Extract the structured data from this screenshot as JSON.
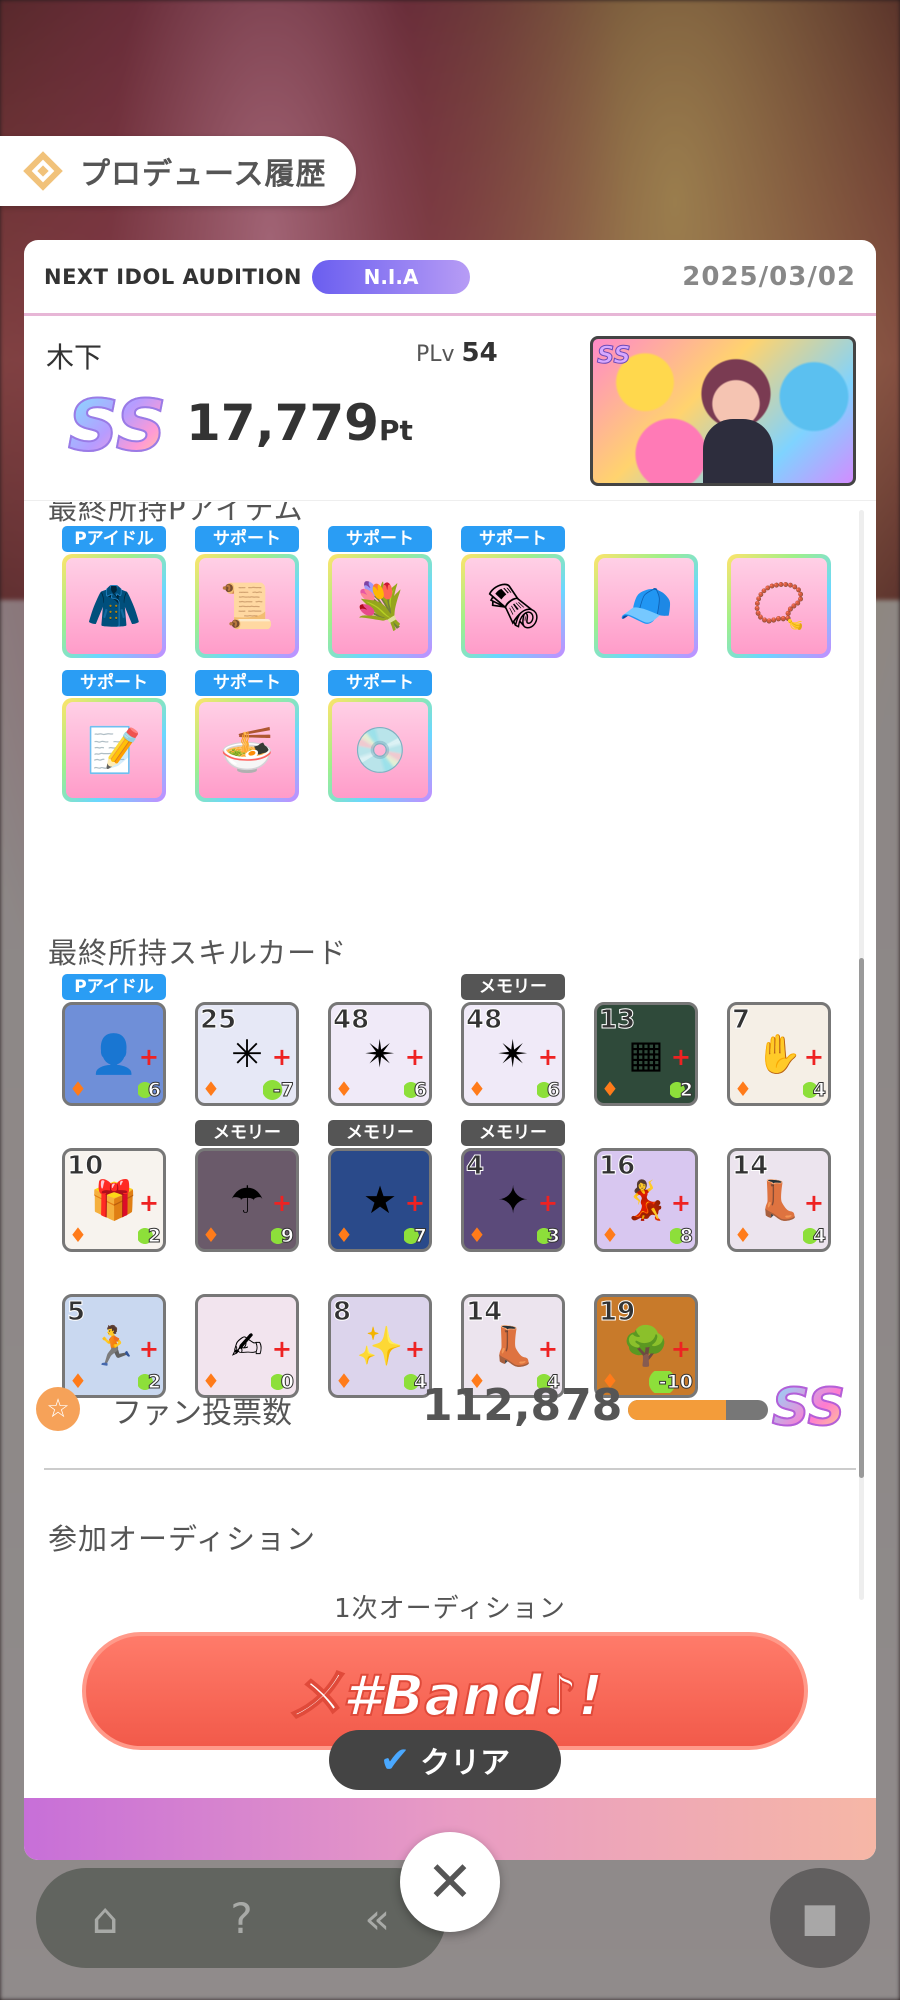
{
  "header": {
    "title": "プロデュース履歴"
  },
  "audition": {
    "name": "NEXT IDOL AUDITION",
    "badge": "N.I.A",
    "date": "2025/03/02"
  },
  "summary": {
    "player_name": "木下",
    "plv_label": "PLv",
    "plv_value": "54",
    "rank": "SS",
    "score": "17,779",
    "score_unit": "Pt",
    "thumb_rank": "SS"
  },
  "items_section": {
    "title": "最終所持Pアイテム",
    "items": [
      {
        "tag": "Pアイドル",
        "tag_color": "blue",
        "icon": "jacket-icon",
        "glyph": "🧥"
      },
      {
        "tag": "サポート",
        "tag_color": "blue",
        "icon": "certificate-icon",
        "glyph": "📜"
      },
      {
        "tag": "サポート",
        "tag_color": "blue",
        "icon": "bouquet-icon",
        "glyph": "💐"
      },
      {
        "tag": "サポート",
        "tag_color": "blue",
        "icon": "poster-icon",
        "glyph": "🗞"
      },
      {
        "tag": "",
        "tag_color": "",
        "icon": "nia-cap-icon",
        "glyph": "🧢"
      },
      {
        "tag": "",
        "tag_color": "",
        "icon": "bracelet-icon",
        "glyph": "📿"
      },
      {
        "tag": "サポート",
        "tag_color": "blue",
        "icon": "notepad-icon",
        "glyph": "📝"
      },
      {
        "tag": "サポート",
        "tag_color": "blue",
        "icon": "ramen-ticket-icon",
        "glyph": "🍜"
      },
      {
        "tag": "サポート",
        "tag_color": "blue",
        "icon": "record-icon",
        "glyph": "💿"
      }
    ]
  },
  "skills_section": {
    "title": "最終所持スキルカード",
    "cards": [
      {
        "tag": "Pアイドル",
        "tag_color": "blue",
        "cost": "",
        "leaf": "6",
        "bg": "#6f8fd8",
        "glyph": "👤"
      },
      {
        "tag": "",
        "tag_color": "",
        "cost": "25",
        "leaf": "-7",
        "bg": "#e6e8f6",
        "glyph": "✳"
      },
      {
        "tag": "",
        "tag_color": "",
        "cost": "48",
        "leaf": "6",
        "bg": "#f0eaf8",
        "glyph": "✴"
      },
      {
        "tag": "メモリー",
        "tag_color": "dark",
        "cost": "48",
        "leaf": "6",
        "bg": "#f0eaf8",
        "glyph": "✴"
      },
      {
        "tag": "",
        "tag_color": "",
        "cost": "13",
        "leaf": "2",
        "bg": "#2f4a3a",
        "glyph": "▦"
      },
      {
        "tag": "",
        "tag_color": "",
        "cost": "7",
        "leaf": "4",
        "bg": "#f5efe6",
        "glyph": "✋"
      },
      {
        "tag": "",
        "tag_color": "",
        "cost": "10",
        "leaf": "2",
        "bg": "#f7f3ee",
        "glyph": "🎁"
      },
      {
        "tag": "メモリー",
        "tag_color": "dark",
        "cost": "",
        "leaf": "9",
        "bg": "#6a5a6a",
        "glyph": "☂"
      },
      {
        "tag": "メモリー",
        "tag_color": "dark",
        "cost": "",
        "leaf": "7",
        "bg": "#2a4a8a",
        "glyph": "★"
      },
      {
        "tag": "メモリー",
        "tag_color": "dark",
        "cost": "4",
        "leaf": "3",
        "bg": "#5b4a7a",
        "glyph": "✦"
      },
      {
        "tag": "",
        "tag_color": "",
        "cost": "16",
        "leaf": "8",
        "bg": "#d8c7f0",
        "glyph": "💃"
      },
      {
        "tag": "",
        "tag_color": "",
        "cost": "14",
        "leaf": "4",
        "bg": "#ece4ee",
        "glyph": "👢"
      },
      {
        "tag": "",
        "tag_color": "",
        "cost": "5",
        "leaf": "2",
        "bg": "#c9d8f0",
        "glyph": "🏃"
      },
      {
        "tag": "",
        "tag_color": "",
        "cost": "",
        "leaf": "0",
        "bg": "#f2e4ee",
        "glyph": "✍"
      },
      {
        "tag": "",
        "tag_color": "",
        "cost": "8",
        "leaf": "4",
        "bg": "#dcd4ec",
        "glyph": "✨"
      },
      {
        "tag": "",
        "tag_color": "",
        "cost": "14",
        "leaf": "4",
        "bg": "#ece4ee",
        "glyph": "👢"
      },
      {
        "tag": "",
        "tag_color": "",
        "cost": "19",
        "leaf": "-10",
        "bg": "#c87a2a",
        "glyph": "🌳"
      }
    ]
  },
  "fans": {
    "label": "ファン投票数",
    "value": "112,878",
    "progress": 0.7,
    "rank": "SS"
  },
  "participation": {
    "title": "参加オーディション",
    "round": "1次オーディション",
    "stage_logo": "メ#Band♪!",
    "status": "クリア"
  },
  "colors": {
    "accent": "#2a9df4",
    "fan_bar": "#f39c3a",
    "footer": "#e89bc4"
  }
}
